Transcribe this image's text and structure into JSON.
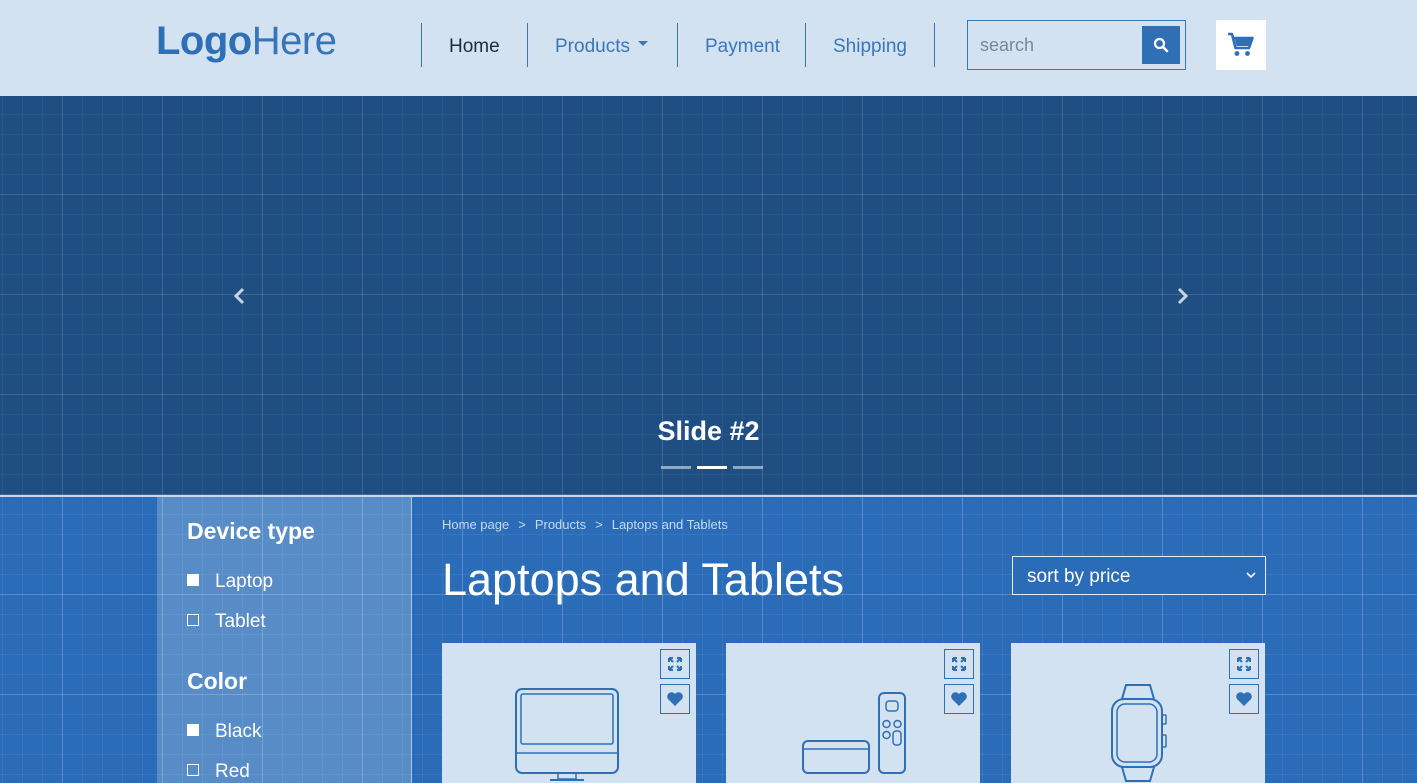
{
  "header": {
    "logo_bold": "Logo",
    "logo_thin": "Here",
    "nav": [
      {
        "label": "Home",
        "active": true
      },
      {
        "label": "Products",
        "dropdown": true
      },
      {
        "label": "Payment"
      },
      {
        "label": "Shipping"
      }
    ],
    "search": {
      "placeholder": "search",
      "icon": "search-icon"
    },
    "cart": {
      "icon": "shopping-cart-icon"
    }
  },
  "hero": {
    "caption": "Slide #2",
    "prev_icon": "chevron-left-icon",
    "next_icon": "chevron-right-icon",
    "slide_count": 3,
    "active_slide": 2
  },
  "sidebar": {
    "groups": [
      {
        "title": "Device type",
        "options": [
          {
            "label": "Laptop",
            "checked": true
          },
          {
            "label": "Tablet",
            "checked": false
          }
        ]
      },
      {
        "title": "Color",
        "options": [
          {
            "label": "Black",
            "checked": true
          },
          {
            "label": "Red",
            "checked": false
          }
        ]
      }
    ]
  },
  "content": {
    "breadcrumb": [
      "Home page",
      "Products",
      "Laptops and Tablets"
    ],
    "breadcrumb_sep": ">",
    "title": "Laptops and Tablets",
    "sort": {
      "selected": "sort by price"
    },
    "products": [
      {
        "image": "desktop-computer-icon"
      },
      {
        "image": "tv-box-and-remote-icon"
      },
      {
        "image": "smartwatch-icon"
      }
    ],
    "card_actions": [
      "expand-icon",
      "heart-icon"
    ]
  },
  "colors": {
    "header_bg": "#d3e2f1",
    "accent": "#2f6fb6",
    "hero_bg": "#1f4f82",
    "main_bg": "#2a6cb8",
    "text_dark": "#1d2b3a"
  }
}
